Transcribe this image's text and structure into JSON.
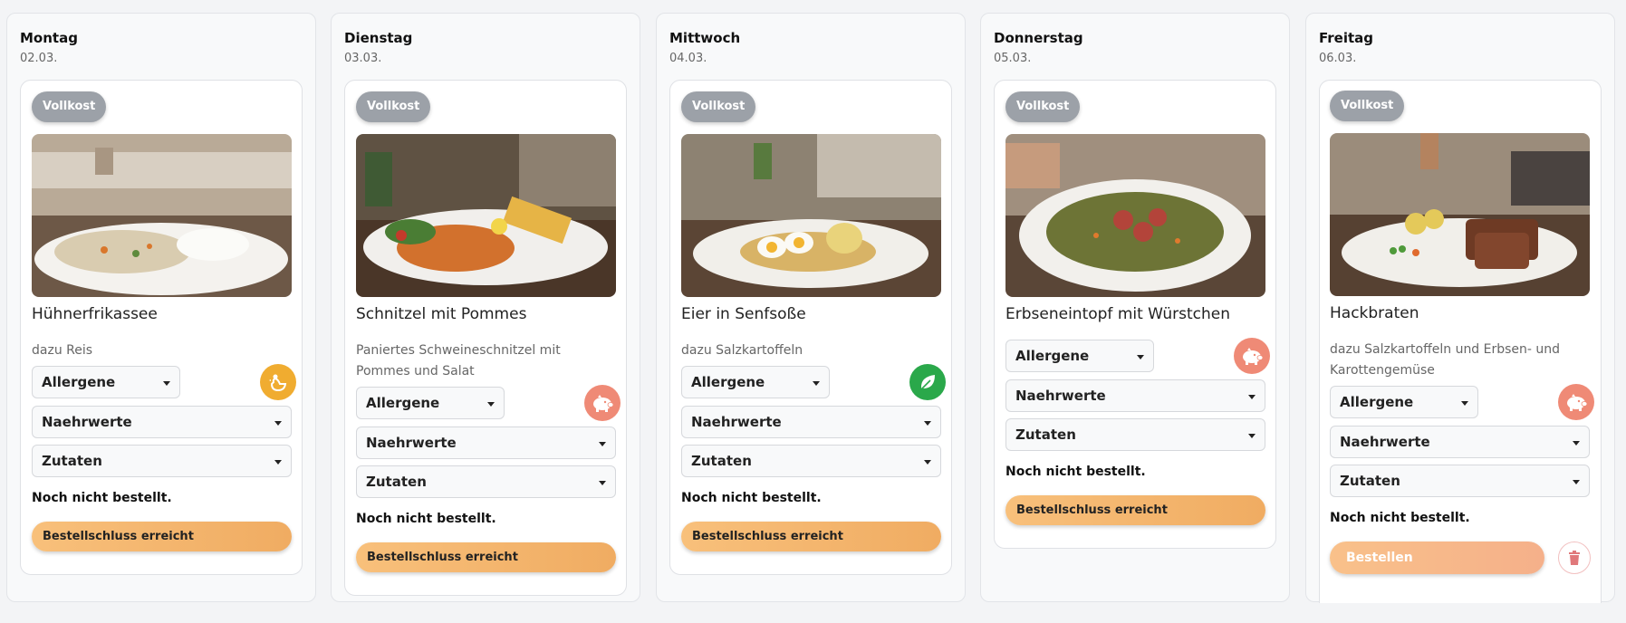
{
  "days": [
    {
      "name": "Montag",
      "date": "02.03.",
      "badge": "Vollkost",
      "dish": "Hühnerfrikassee",
      "description": "dazu Reis",
      "diet_icon": "chicken-icon",
      "diet_color": "#f0ac30",
      "allergens_label": "Allergene",
      "nutrition_label": "Naehrwerte",
      "ingredients_label": "Zutaten",
      "status": "Noch nicht bestellt.",
      "action_label": "Bestellschluss erreicht"
    },
    {
      "name": "Dienstag",
      "date": "03.03.",
      "badge": "Vollkost",
      "dish": "Schnitzel mit Pommes",
      "description": "Paniertes Schweineschnitzel mit Pommes und Salat",
      "diet_icon": "pig-icon",
      "diet_color": "#ef8a76",
      "allergens_label": "Allergene",
      "nutrition_label": "Naehrwerte",
      "ingredients_label": "Zutaten",
      "status": "Noch nicht bestellt.",
      "action_label": "Bestellschluss erreicht"
    },
    {
      "name": "Mittwoch",
      "date": "04.03.",
      "badge": "Vollkost",
      "dish": "Eier in Senfsoße",
      "description": "dazu Salzkartoffeln",
      "diet_icon": "leaf-icon",
      "diet_color": "#2aa84a",
      "allergens_label": "Allergene",
      "nutrition_label": "Naehrwerte",
      "ingredients_label": "Zutaten",
      "status": "Noch nicht bestellt.",
      "action_label": "Bestellschluss erreicht"
    },
    {
      "name": "Donnerstag",
      "date": "05.03.",
      "badge": "Vollkost",
      "dish": "Erbseneintopf mit Würstchen",
      "description": "",
      "diet_icon": "pig-icon",
      "diet_color": "#ef8a76",
      "allergens_label": "Allergene",
      "nutrition_label": "Naehrwerte",
      "ingredients_label": "Zutaten",
      "status": "Noch nicht bestellt.",
      "action_label": "Bestellschluss erreicht"
    },
    {
      "name": "Freitag",
      "date": "06.03.",
      "badge": "Vollkost",
      "dish": "Hackbraten",
      "description": "dazu Salzkartoffeln und Erbsen- und Karottengemüse",
      "diet_icon": "pig-icon",
      "diet_color": "#ef8a76",
      "allergens_label": "Allergene",
      "nutrition_label": "Naehrwerte",
      "ingredients_label": "Zutaten",
      "status": "Noch nicht bestellt.",
      "action_label": "Bestellen",
      "delete_icon": "trash-icon"
    }
  ]
}
